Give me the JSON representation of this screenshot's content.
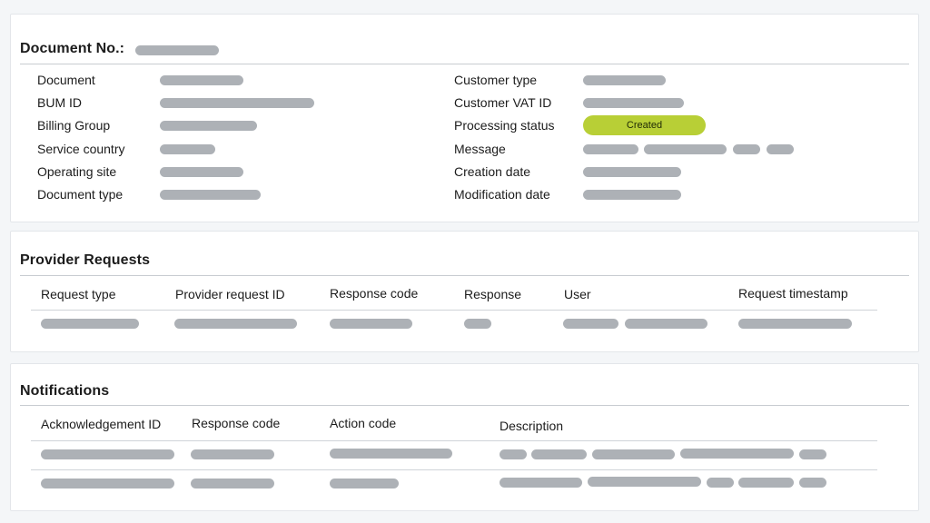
{
  "document_card": {
    "title": "Document No.:",
    "left_fields": [
      {
        "label": "Document"
      },
      {
        "label": "BUM ID"
      },
      {
        "label": "Billing Group"
      },
      {
        "label": "Service country"
      },
      {
        "label": "Operating site"
      },
      {
        "label": "Document type"
      }
    ],
    "right_fields": [
      {
        "label": "Customer type"
      },
      {
        "label": "Customer VAT ID"
      },
      {
        "label": "Processing status"
      },
      {
        "label": "Message"
      },
      {
        "label": "Creation date"
      },
      {
        "label": "Modification date"
      }
    ],
    "processing_status": {
      "value": "Created",
      "color": "#b8cf36"
    }
  },
  "provider_requests": {
    "title": "Provider Requests",
    "columns": [
      "Request type",
      "Provider request ID",
      "Response code",
      "Response",
      "User",
      "Request timestamp"
    ]
  },
  "notifications": {
    "title": "Notifications",
    "columns": [
      "Acknowledgement ID",
      "Response code",
      "Action code",
      "Description"
    ]
  },
  "colors": {
    "placeholder": "#adb1b6",
    "status_created": "#b8cf36"
  }
}
